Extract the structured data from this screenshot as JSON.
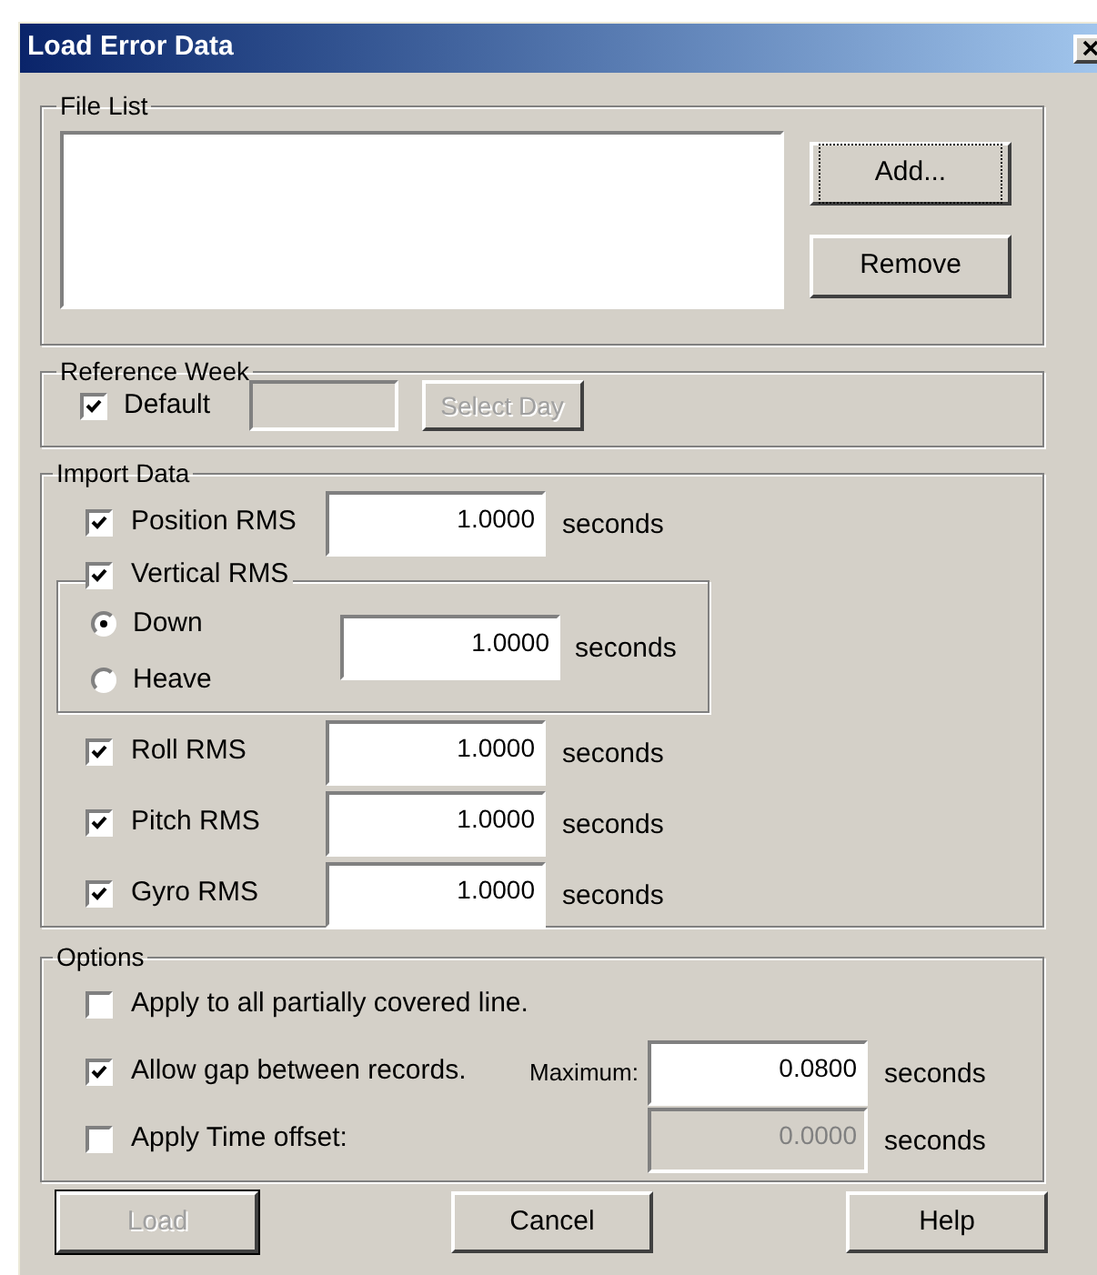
{
  "window": {
    "title": "Load Error Data"
  },
  "file_list": {
    "label": "File List",
    "buttons": [
      {
        "label": "Add...",
        "focused": true
      },
      {
        "label": "Remove",
        "focused": false
      }
    ]
  },
  "reference_week": {
    "label": "Reference Week",
    "default": {
      "label": "Default",
      "checked": true
    },
    "field": {
      "disabled": true
    },
    "button": {
      "label": "Select Day",
      "disabled": true
    }
  },
  "import_data": {
    "label": "Import Data",
    "rows": [
      {
        "kind": "checkbox",
        "label": "Position RMS",
        "checked": true,
        "value": "1.0000",
        "unit": "seconds"
      },
      {
        "kind": "group",
        "label": "Vertical RMS",
        "checked": true,
        "options": [
          {
            "label": "Down",
            "selected": true
          },
          {
            "label": "Heave",
            "selected": false
          }
        ],
        "value": "1.0000",
        "unit": "seconds"
      },
      {
        "kind": "checkbox",
        "label": "Roll RMS",
        "checked": true,
        "value": "1.0000",
        "unit": "seconds"
      },
      {
        "kind": "checkbox",
        "label": "Pitch RMS",
        "checked": true,
        "value": "1.0000",
        "unit": "seconds"
      },
      {
        "kind": "checkbox",
        "label": "Gyro RMS",
        "checked": true,
        "value": "1.0000",
        "unit": "seconds"
      }
    ]
  },
  "options": {
    "label": "Options",
    "rows": [
      {
        "label": "Apply to all partially covered line.",
        "checked": false
      },
      {
        "label": "Allow gap between records.",
        "checked": true,
        "field_label": "Maximum:",
        "value": "0.0800",
        "unit": "seconds",
        "disabled": false
      },
      {
        "label": "Apply Time offset:",
        "checked": false,
        "value": "0.0000",
        "unit": "seconds",
        "disabled": true
      }
    ]
  },
  "buttons": [
    {
      "label": "Load",
      "disabled": true
    },
    {
      "label": "Cancel",
      "disabled": false
    },
    {
      "label": "Help",
      "disabled": false
    }
  ]
}
